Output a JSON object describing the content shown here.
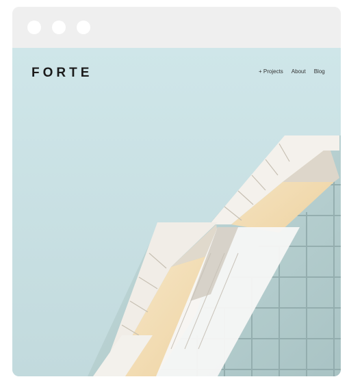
{
  "site": {
    "logo": "FORTE",
    "nav": [
      {
        "label": "+ Projects"
      },
      {
        "label": "About"
      },
      {
        "label": "Blog"
      }
    ]
  },
  "window": {
    "controls": [
      "window-dot",
      "window-dot",
      "window-dot"
    ]
  },
  "colors": {
    "sky": "#c9e1e4",
    "facade": "#b6cfcf",
    "panel_light": "#f4f1ec",
    "panel_shadow": "#d9d3c8",
    "inner": "#f3ddb1",
    "text": "#1b1b1b"
  }
}
